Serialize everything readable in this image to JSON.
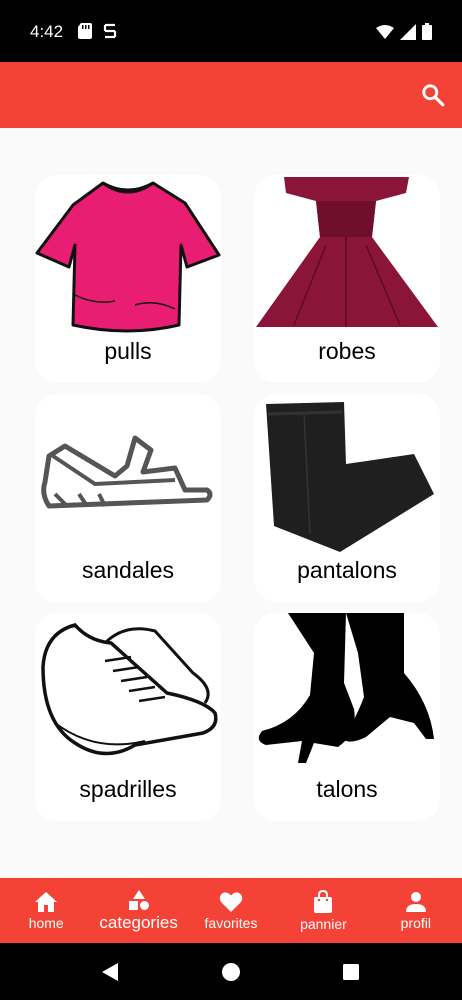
{
  "status_bar": {
    "time": "4:42"
  },
  "app_bar": {
    "search_icon": "search-icon"
  },
  "categories": [
    {
      "label": "pulls"
    },
    {
      "label": "robes"
    },
    {
      "label": "sandales"
    },
    {
      "label": "pantalons"
    },
    {
      "label": "spadrilles"
    },
    {
      "label": "talons"
    }
  ],
  "bottom_nav": {
    "items": [
      {
        "label": "home",
        "icon": "home-icon"
      },
      {
        "label": "categories",
        "icon": "categories-icon",
        "active": true
      },
      {
        "label": "favorites",
        "icon": "heart-icon"
      },
      {
        "label": "pannier",
        "icon": "shopping-bag-icon"
      },
      {
        "label": "profil",
        "icon": "person-icon"
      }
    ]
  },
  "colors": {
    "accent": "#f44336",
    "background": "#fafafa",
    "card": "#ffffff"
  }
}
